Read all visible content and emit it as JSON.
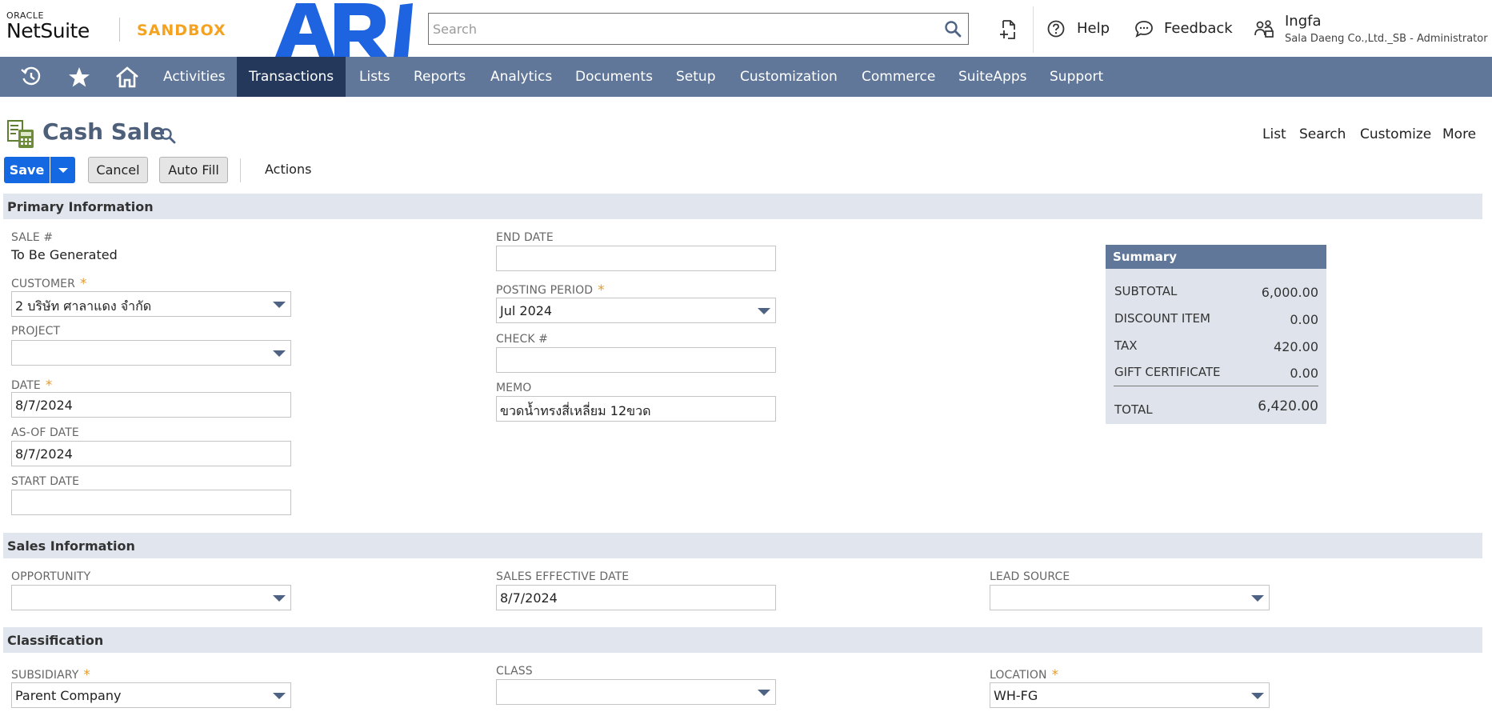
{
  "header": {
    "logo_top": "ORACLE",
    "logo_bottom": "NetSuite",
    "env_badge": "SANDBOX",
    "brand_logo_text": "ARI",
    "search_placeholder": "Search",
    "help": "Help",
    "feedback": "Feedback",
    "user_name": "Ingfa",
    "user_role": "Sala Daeng Co.,Ltd._SB - Administrator"
  },
  "nav": {
    "items": [
      "Activities",
      "Transactions",
      "Lists",
      "Reports",
      "Analytics",
      "Documents",
      "Setup",
      "Customization",
      "Commerce",
      "SuiteApps",
      "Support"
    ],
    "active": "Transactions"
  },
  "page": {
    "title": "Cash Sale",
    "links": [
      "List",
      "Search",
      "Customize",
      "More"
    ]
  },
  "buttons": {
    "save": "Save",
    "cancel": "Cancel",
    "auto_fill": "Auto Fill",
    "actions": "Actions"
  },
  "sections": {
    "primary": "Primary Information",
    "sales": "Sales Information",
    "classification": "Classification"
  },
  "primary": {
    "sale_no": {
      "label": "Sale #",
      "value": "To Be Generated"
    },
    "customer": {
      "label": "Customer",
      "value": "2 บริษัท ศาลาแดง จำกัด"
    },
    "project": {
      "label": "Project",
      "value": ""
    },
    "date": {
      "label": "Date",
      "value": "8/7/2024"
    },
    "as_of_date": {
      "label": "As-Of Date",
      "value": "8/7/2024"
    },
    "start_date": {
      "label": "Start Date",
      "value": ""
    },
    "end_date": {
      "label": "End Date",
      "value": ""
    },
    "posting_period": {
      "label": "Posting Period",
      "value": "Jul 2024"
    },
    "check_no": {
      "label": "Check #",
      "value": ""
    },
    "memo": {
      "label": "Memo",
      "value": "ขวดน้ำทรงสี่เหลี่ยม 12ขวด"
    },
    "required_mark": "*"
  },
  "summary": {
    "title": "Summary",
    "rows": [
      {
        "label": "Subtotal",
        "value": "6,000.00"
      },
      {
        "label": "Discount Item",
        "value": "0.00"
      },
      {
        "label": "Tax",
        "value": "420.00"
      },
      {
        "label": "Gift Certificate",
        "value": "0.00"
      }
    ],
    "total_label": "Total",
    "total_value": "6,420.00"
  },
  "sales": {
    "opportunity": {
      "label": "Opportunity",
      "value": ""
    },
    "sales_effective_date": {
      "label": "Sales Effective Date",
      "value": "8/7/2024"
    },
    "lead_source": {
      "label": "Lead Source",
      "value": ""
    }
  },
  "classification": {
    "subsidiary": {
      "label": "Subsidiary",
      "value": "Parent Company"
    },
    "class": {
      "label": "Class",
      "value": ""
    },
    "location": {
      "label": "Location",
      "value": "WH-FG"
    }
  },
  "colors": {
    "nav_bg": "#607799",
    "nav_active": "#24385b",
    "primary_button": "#1468e2",
    "sandbox": "#f4a21f",
    "brand_blue": "#1e63e0",
    "required": "#e49b2d",
    "section_bg": "#e0e5ee"
  },
  "icons": [
    "recent-records-icon",
    "star-icon",
    "home-icon",
    "search-icon",
    "record-add-icon",
    "help-circle-icon",
    "chat-bubble-icon",
    "role-switch-icon",
    "cash-sale-record-icon",
    "chevron-down-icon"
  ]
}
